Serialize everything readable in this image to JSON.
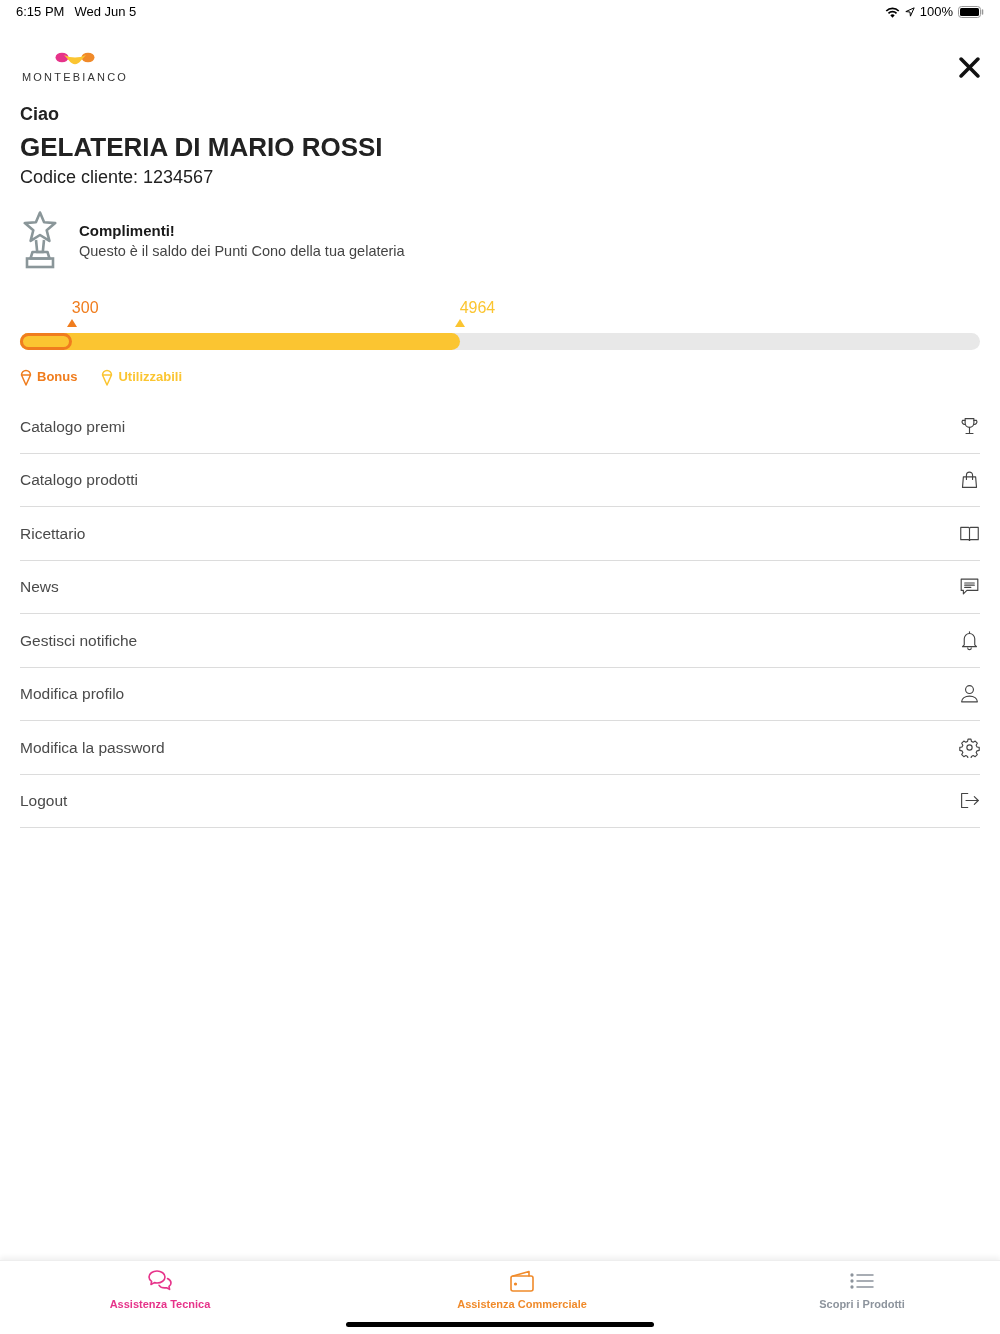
{
  "status_bar": {
    "time": "6:15 PM",
    "date": "Wed Jun 5",
    "battery": "100%"
  },
  "header": {
    "logo_text": "MONTEBIANCO"
  },
  "greeting": {
    "salutation": "Ciao",
    "business_name": "GELATERIA DI MARIO ROSSI",
    "customer_code": "Codice cliente: 1234567"
  },
  "message": {
    "title": "Complimenti!",
    "text": "Questo è il saldo dei Punti Cono della tua gelateria"
  },
  "points": {
    "bars": [
      {
        "kind": "outline",
        "value": "300",
        "level": 0.054,
        "color": "#f07d1e"
      },
      {
        "kind": "fill",
        "value": "4964",
        "level": 0.458,
        "color": "#fbc531"
      }
    ],
    "legend": [
      {
        "label": "Bonus",
        "color": "#f07d1e"
      },
      {
        "label": "Utilizzabili",
        "color": "#fbc531"
      }
    ]
  },
  "menu": [
    {
      "label": "Catalogo premi"
    },
    {
      "label": "Catalogo prodotti"
    },
    {
      "label": "Ricettario"
    },
    {
      "label": "News"
    },
    {
      "label": "Gestisci notifiche"
    },
    {
      "label": "Modifica profilo"
    },
    {
      "label": "Modifica la password"
    },
    {
      "label": "Logout"
    }
  ],
  "tab_bar": [
    {
      "label": "Assistenza Tecnica",
      "color": "#e6338a"
    },
    {
      "label": "Assistenza Commerciale",
      "color": "#f08a2a"
    },
    {
      "label": "Scopri i Prodotti",
      "color": "#8c939c"
    }
  ]
}
